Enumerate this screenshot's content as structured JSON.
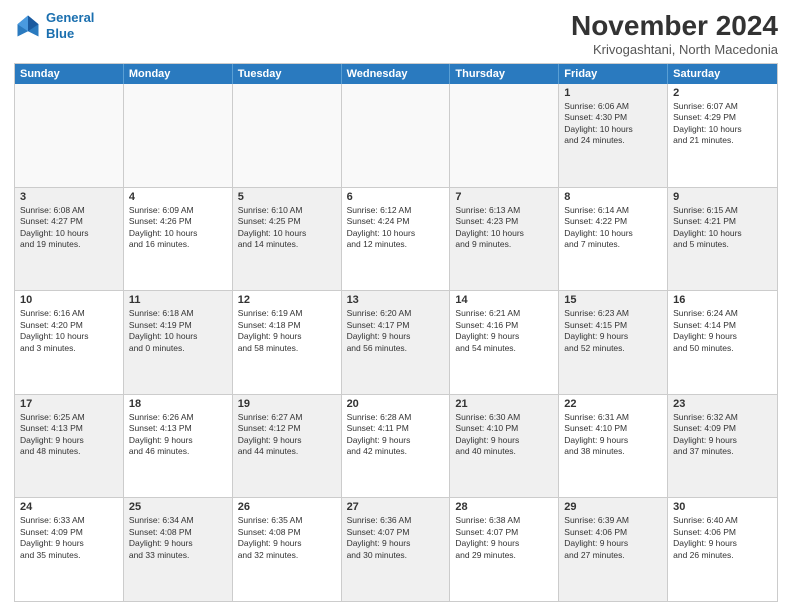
{
  "header": {
    "title": "November 2024",
    "location": "Krivogashtani, North Macedonia",
    "logo_line1": "General",
    "logo_line2": "Blue"
  },
  "weekdays": [
    "Sunday",
    "Monday",
    "Tuesday",
    "Wednesday",
    "Thursday",
    "Friday",
    "Saturday"
  ],
  "rows": [
    [
      {
        "day": "",
        "info": "",
        "empty": true
      },
      {
        "day": "",
        "info": "",
        "empty": true
      },
      {
        "day": "",
        "info": "",
        "empty": true
      },
      {
        "day": "",
        "info": "",
        "empty": true
      },
      {
        "day": "",
        "info": "",
        "empty": true
      },
      {
        "day": "1",
        "info": "Sunrise: 6:06 AM\nSunset: 4:30 PM\nDaylight: 10 hours\nand 24 minutes.",
        "empty": false,
        "shaded": true
      },
      {
        "day": "2",
        "info": "Sunrise: 6:07 AM\nSunset: 4:29 PM\nDaylight: 10 hours\nand 21 minutes.",
        "empty": false,
        "shaded": false
      }
    ],
    [
      {
        "day": "3",
        "info": "Sunrise: 6:08 AM\nSunset: 4:27 PM\nDaylight: 10 hours\nand 19 minutes.",
        "empty": false,
        "shaded": true
      },
      {
        "day": "4",
        "info": "Sunrise: 6:09 AM\nSunset: 4:26 PM\nDaylight: 10 hours\nand 16 minutes.",
        "empty": false,
        "shaded": false
      },
      {
        "day": "5",
        "info": "Sunrise: 6:10 AM\nSunset: 4:25 PM\nDaylight: 10 hours\nand 14 minutes.",
        "empty": false,
        "shaded": true
      },
      {
        "day": "6",
        "info": "Sunrise: 6:12 AM\nSunset: 4:24 PM\nDaylight: 10 hours\nand 12 minutes.",
        "empty": false,
        "shaded": false
      },
      {
        "day": "7",
        "info": "Sunrise: 6:13 AM\nSunset: 4:23 PM\nDaylight: 10 hours\nand 9 minutes.",
        "empty": false,
        "shaded": true
      },
      {
        "day": "8",
        "info": "Sunrise: 6:14 AM\nSunset: 4:22 PM\nDaylight: 10 hours\nand 7 minutes.",
        "empty": false,
        "shaded": false
      },
      {
        "day": "9",
        "info": "Sunrise: 6:15 AM\nSunset: 4:21 PM\nDaylight: 10 hours\nand 5 minutes.",
        "empty": false,
        "shaded": true
      }
    ],
    [
      {
        "day": "10",
        "info": "Sunrise: 6:16 AM\nSunset: 4:20 PM\nDaylight: 10 hours\nand 3 minutes.",
        "empty": false,
        "shaded": false
      },
      {
        "day": "11",
        "info": "Sunrise: 6:18 AM\nSunset: 4:19 PM\nDaylight: 10 hours\nand 0 minutes.",
        "empty": false,
        "shaded": true
      },
      {
        "day": "12",
        "info": "Sunrise: 6:19 AM\nSunset: 4:18 PM\nDaylight: 9 hours\nand 58 minutes.",
        "empty": false,
        "shaded": false
      },
      {
        "day": "13",
        "info": "Sunrise: 6:20 AM\nSunset: 4:17 PM\nDaylight: 9 hours\nand 56 minutes.",
        "empty": false,
        "shaded": true
      },
      {
        "day": "14",
        "info": "Sunrise: 6:21 AM\nSunset: 4:16 PM\nDaylight: 9 hours\nand 54 minutes.",
        "empty": false,
        "shaded": false
      },
      {
        "day": "15",
        "info": "Sunrise: 6:23 AM\nSunset: 4:15 PM\nDaylight: 9 hours\nand 52 minutes.",
        "empty": false,
        "shaded": true
      },
      {
        "day": "16",
        "info": "Sunrise: 6:24 AM\nSunset: 4:14 PM\nDaylight: 9 hours\nand 50 minutes.",
        "empty": false,
        "shaded": false
      }
    ],
    [
      {
        "day": "17",
        "info": "Sunrise: 6:25 AM\nSunset: 4:13 PM\nDaylight: 9 hours\nand 48 minutes.",
        "empty": false,
        "shaded": true
      },
      {
        "day": "18",
        "info": "Sunrise: 6:26 AM\nSunset: 4:13 PM\nDaylight: 9 hours\nand 46 minutes.",
        "empty": false,
        "shaded": false
      },
      {
        "day": "19",
        "info": "Sunrise: 6:27 AM\nSunset: 4:12 PM\nDaylight: 9 hours\nand 44 minutes.",
        "empty": false,
        "shaded": true
      },
      {
        "day": "20",
        "info": "Sunrise: 6:28 AM\nSunset: 4:11 PM\nDaylight: 9 hours\nand 42 minutes.",
        "empty": false,
        "shaded": false
      },
      {
        "day": "21",
        "info": "Sunrise: 6:30 AM\nSunset: 4:10 PM\nDaylight: 9 hours\nand 40 minutes.",
        "empty": false,
        "shaded": true
      },
      {
        "day": "22",
        "info": "Sunrise: 6:31 AM\nSunset: 4:10 PM\nDaylight: 9 hours\nand 38 minutes.",
        "empty": false,
        "shaded": false
      },
      {
        "day": "23",
        "info": "Sunrise: 6:32 AM\nSunset: 4:09 PM\nDaylight: 9 hours\nand 37 minutes.",
        "empty": false,
        "shaded": true
      }
    ],
    [
      {
        "day": "24",
        "info": "Sunrise: 6:33 AM\nSunset: 4:09 PM\nDaylight: 9 hours\nand 35 minutes.",
        "empty": false,
        "shaded": false
      },
      {
        "day": "25",
        "info": "Sunrise: 6:34 AM\nSunset: 4:08 PM\nDaylight: 9 hours\nand 33 minutes.",
        "empty": false,
        "shaded": true
      },
      {
        "day": "26",
        "info": "Sunrise: 6:35 AM\nSunset: 4:08 PM\nDaylight: 9 hours\nand 32 minutes.",
        "empty": false,
        "shaded": false
      },
      {
        "day": "27",
        "info": "Sunrise: 6:36 AM\nSunset: 4:07 PM\nDaylight: 9 hours\nand 30 minutes.",
        "empty": false,
        "shaded": true
      },
      {
        "day": "28",
        "info": "Sunrise: 6:38 AM\nSunset: 4:07 PM\nDaylight: 9 hours\nand 29 minutes.",
        "empty": false,
        "shaded": false
      },
      {
        "day": "29",
        "info": "Sunrise: 6:39 AM\nSunset: 4:06 PM\nDaylight: 9 hours\nand 27 minutes.",
        "empty": false,
        "shaded": true
      },
      {
        "day": "30",
        "info": "Sunrise: 6:40 AM\nSunset: 4:06 PM\nDaylight: 9 hours\nand 26 minutes.",
        "empty": false,
        "shaded": false
      }
    ]
  ]
}
